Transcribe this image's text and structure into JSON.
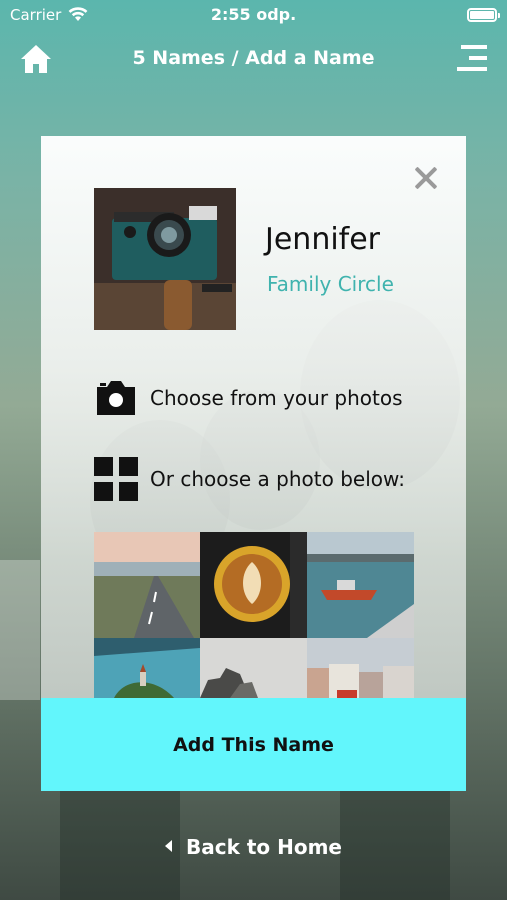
{
  "status_bar": {
    "carrier": "Carrier",
    "time": "2:55 odp.",
    "wifi_icon": "wifi-icon",
    "battery_icon": "battery-icon"
  },
  "nav": {
    "title": "5 Names / Add a Name",
    "home_icon": "home-icon",
    "menu_icon": "menu-icon"
  },
  "card": {
    "close_icon": "close-icon",
    "selected_photo": "camera-photo",
    "name": "Jennifer",
    "circle": "Family Circle",
    "choose_photos_label": "Choose from your photos",
    "choose_below_label": "Or choose a photo below:",
    "photos": [
      "road-photo",
      "coffee-photo",
      "boat-photo",
      "lake-church-photo",
      "rocks-photo",
      "city-photo"
    ],
    "add_button_label": "Add This Name"
  },
  "footer": {
    "back_label": "Back to Home"
  },
  "colors": {
    "accent": "#3fb3ae",
    "button": "#62f6fc",
    "header": "#5bb6ad"
  }
}
